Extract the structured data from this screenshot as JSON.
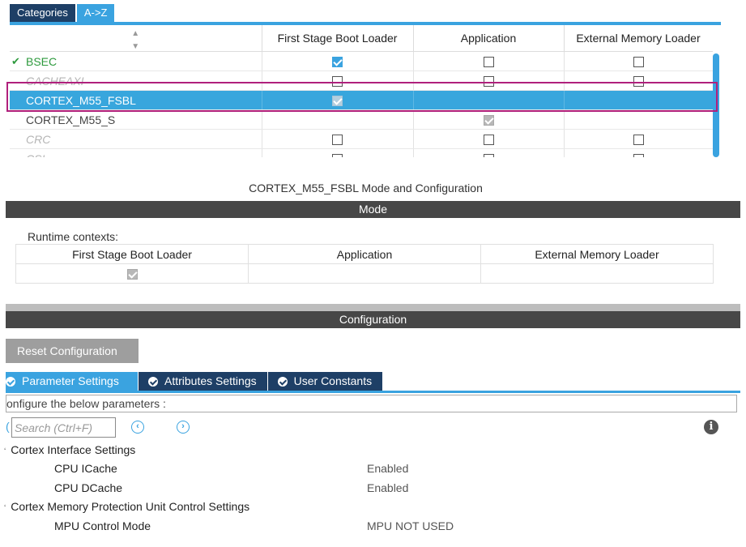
{
  "peripheral_tabs": [
    "Categories",
    "A->Z"
  ],
  "peripheral_table": {
    "headers": [
      "",
      "First Stage Boot Loader",
      "Application",
      "External Memory Loader"
    ],
    "rows": [
      {
        "name": "BSEC",
        "state": "ok",
        "fsbl": "checked",
        "app": "unchecked",
        "ext": "unchecked"
      },
      {
        "name": "CACHEAXI",
        "state": "disabled",
        "fsbl": "unchecked",
        "app": "unchecked",
        "ext": "unchecked"
      },
      {
        "name": "CORTEX_M55_FSBL",
        "state": "selected",
        "fsbl": "grey",
        "app": "none",
        "ext": "none"
      },
      {
        "name": "CORTEX_M55_S",
        "state": "normal",
        "fsbl": "none",
        "app": "grey",
        "ext": "none"
      },
      {
        "name": "CRC",
        "state": "disabled",
        "fsbl": "unchecked",
        "app": "unchecked",
        "ext": "unchecked"
      },
      {
        "name": "CSI",
        "state": "disabled",
        "fsbl": "unchecked",
        "app": "unchecked",
        "ext": "unchecked"
      }
    ]
  },
  "mode_config_title": "CORTEX_M55_FSBL Mode and Configuration",
  "mode_bar": "Mode",
  "runtime": {
    "label": "Runtime contexts:",
    "headers": [
      "First Stage Boot Loader",
      "Application",
      "External Memory Loader"
    ],
    "values": [
      "grey",
      "none",
      "none"
    ]
  },
  "configuration_bar": "Configuration",
  "reset_button": "Reset Configuration",
  "param_tabs": [
    "Parameter Settings",
    "Attributes Settings",
    "User Constants"
  ],
  "configure_text": "onfigure the below parameters :",
  "search": {
    "placeholder": "Search (Ctrl+F)"
  },
  "icons": {
    "check": "check-icon",
    "sort": "sort-icon",
    "prev": "previous-circle-icon",
    "next": "next-circle-icon",
    "info": "info-icon",
    "ok": "check-circle-icon"
  },
  "tree": [
    {
      "type": "group",
      "label": "Cortex Interface Settings"
    },
    {
      "type": "param",
      "label": "CPU ICache",
      "value": "Enabled"
    },
    {
      "type": "param",
      "label": "CPU DCache",
      "value": "Enabled"
    },
    {
      "type": "group",
      "label": "Cortex Memory Protection Unit Control Settings"
    },
    {
      "type": "param",
      "label": "MPU Control Mode",
      "value": "MPU NOT USED"
    }
  ],
  "colors": {
    "accent": "#3aa3e0",
    "dark_tab": "#1e3f66",
    "section_bar": "#474747",
    "highlight_outline": "#b0207c",
    "ok_green": "#2e9a3e"
  }
}
